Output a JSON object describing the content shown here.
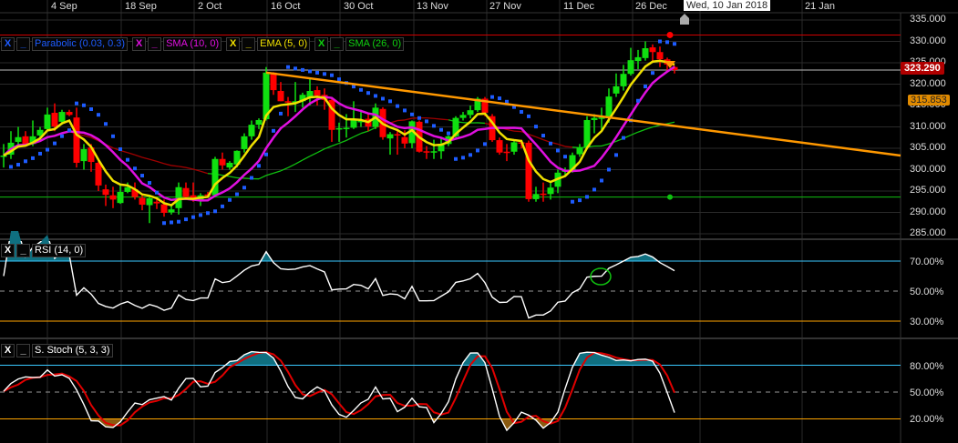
{
  "header": {
    "dates": [
      "4 Sep",
      "18 Sep",
      "2 Oct",
      "16 Oct",
      "30 Oct",
      "13 Nov",
      "27 Nov",
      "11 Dec",
      "26 Dec",
      "21 Jan"
    ],
    "crosshair_date": "Wed, 10 Jan 2018"
  },
  "legend": {
    "main": [
      {
        "label": "Parabolic (0.03, 0.3)",
        "color": "#1e5cff"
      },
      {
        "label": "SMA (10, 0)",
        "color": "#e010e0"
      },
      {
        "label": "EMA (5, 0)",
        "color": "#f0e000"
      },
      {
        "label": "SMA (26, 0)",
        "color": "#10d010"
      }
    ],
    "rsi": "RSI (14, 0)",
    "stoch": "S. Stoch (5, 3, 3)",
    "close_symbol": "X",
    "min_symbol": "_"
  },
  "axis": {
    "price_ticks": [
      "335.000",
      "330.000",
      "325.000",
      "320.000",
      "315.000",
      "310.000",
      "305.000",
      "300.000",
      "295.000",
      "290.000",
      "285.000"
    ],
    "rsi_ticks": [
      "70.00%",
      "50.00%",
      "30.00%"
    ],
    "stoch_ticks": [
      "80.00%",
      "50.00%",
      "20.00%"
    ]
  },
  "tags": {
    "last_price": "323.290",
    "orange_level": "315.853"
  },
  "chart_data": {
    "type": "candlestick",
    "ylim": [
      283,
      337
    ],
    "price_levels": {
      "last": 323.29,
      "resistance": 331.5,
      "support": 293.6,
      "trendline": [
        [
          36,
          322.7
        ],
        [
          123,
          303.3
        ]
      ]
    },
    "rsi_levels": [
      70,
      50,
      30
    ],
    "stoch_levels": [
      80,
      50,
      20
    ],
    "ohlc": [
      [
        303.0,
        306,
        300.5,
        303.3
      ],
      [
        303.5,
        309,
        302.5,
        306.3
      ],
      [
        306.5,
        310,
        305.5,
        307.6
      ],
      [
        307.8,
        309,
        306,
        306
      ],
      [
        306,
        311.5,
        305.5,
        307.8
      ],
      [
        308,
        310,
        306.5,
        309.3
      ],
      [
        309.5,
        314.5,
        309,
        312.9
      ],
      [
        313.3,
        315.5,
        309,
        310.1
      ],
      [
        311.2,
        314,
        310.5,
        313.5
      ],
      [
        313.5,
        314,
        312.5,
        312.8
      ],
      [
        312.2,
        314.5,
        300.5,
        301.6
      ],
      [
        302,
        306,
        300,
        304.8
      ],
      [
        305.2,
        306,
        299.5,
        301.8
      ],
      [
        301.6,
        302,
        295,
        296.3
      ],
      [
        295.4,
        296.5,
        291.5,
        294.1
      ],
      [
        294,
        296,
        291,
        293
      ],
      [
        292.2,
        296.5,
        292,
        294.8
      ],
      [
        294.8,
        297,
        294.5,
        295.9
      ],
      [
        295.4,
        297,
        293,
        293.6
      ],
      [
        293.4,
        294,
        290.5,
        291.8
      ],
      [
        291.7,
        294,
        287.5,
        293.3
      ],
      [
        292.5,
        293.5,
        290.8,
        292.1
      ],
      [
        291.9,
        293,
        289,
        289.9
      ],
      [
        290,
        292,
        289.5,
        290.7
      ],
      [
        291,
        297,
        289.5,
        295.9
      ],
      [
        295.7,
        297,
        293,
        293.6
      ],
      [
        294,
        297,
        292.5,
        293
      ],
      [
        292.9,
        294.5,
        291.5,
        294
      ],
      [
        294.2,
        294.8,
        293.6,
        294
      ],
      [
        294,
        303,
        293.8,
        302.5
      ],
      [
        302.5,
        304,
        300,
        301
      ],
      [
        300.5,
        302,
        300,
        301.6
      ],
      [
        301.2,
        304.5,
        300.5,
        304.4
      ],
      [
        304.8,
        308.5,
        304,
        307.8
      ],
      [
        307.8,
        311.5,
        307,
        310.5
      ],
      [
        310.5,
        312,
        309.5,
        311.6
      ],
      [
        311.8,
        324,
        311.5,
        322.7
      ],
      [
        322.7,
        322.8,
        317.5,
        318.6
      ],
      [
        318.4,
        320.5,
        316,
        316
      ],
      [
        316,
        317,
        312.5,
        315.7
      ],
      [
        315.8,
        320.5,
        313.5,
        316
      ],
      [
        316,
        318,
        314.5,
        317.5
      ],
      [
        316.9,
        321.5,
        315,
        318.4
      ],
      [
        318.6,
        319.5,
        315,
        317.3
      ],
      [
        317.5,
        319,
        314,
        316.3
      ],
      [
        316.3,
        317,
        306.5,
        309.3
      ],
      [
        309.5,
        311,
        306.5,
        309.7
      ],
      [
        309.6,
        313,
        307.5,
        309.8
      ],
      [
        309.8,
        316,
        309.5,
        311.7
      ],
      [
        311.4,
        314,
        310,
        311.4
      ],
      [
        311.9,
        313,
        309,
        310.1
      ],
      [
        310,
        315.5,
        309.5,
        314.5
      ],
      [
        314.2,
        314.6,
        307,
        307.6
      ],
      [
        307.3,
        308.8,
        303.5,
        308.3
      ],
      [
        308.3,
        309.5,
        303.5,
        308.0
      ],
      [
        307.6,
        309.2,
        305,
        306.1
      ],
      [
        306.2,
        311.5,
        305,
        311.3
      ],
      [
        311.2,
        311.5,
        304,
        304.2
      ],
      [
        304.3,
        305.5,
        302.5,
        304.2
      ],
      [
        304.2,
        307,
        302.5,
        304.3
      ],
      [
        304.3,
        307.5,
        302.5,
        306
      ],
      [
        306,
        308,
        305.5,
        307.8
      ],
      [
        307.8,
        312.5,
        307.5,
        312.1
      ],
      [
        312.1,
        313.5,
        311.5,
        312.8
      ],
      [
        312.8,
        315,
        312,
        313.9
      ],
      [
        313.9,
        317,
        313.5,
        316.6
      ],
      [
        316.6,
        317,
        312.5,
        313.3
      ],
      [
        312.5,
        313,
        306.5,
        306.9
      ],
      [
        306.9,
        307.5,
        303.5,
        304
      ],
      [
        304.2,
        306,
        302,
        304.1
      ],
      [
        304.2,
        307,
        303.5,
        306.4
      ],
      [
        306.4,
        307,
        305,
        306.3
      ],
      [
        306.3,
        306.8,
        292.5,
        293.1
      ],
      [
        293.1,
        296,
        292.5,
        294.3
      ],
      [
        294.4,
        297,
        292.5,
        294.3
      ],
      [
        294.3,
        297,
        293,
        295.8
      ],
      [
        296,
        300,
        294.5,
        299.3
      ],
      [
        299.6,
        300.5,
        298.5,
        299.8
      ],
      [
        299.9,
        304,
        299.3,
        303.4
      ],
      [
        303.6,
        306,
        303,
        305.2
      ],
      [
        305.2,
        312.5,
        305,
        311.6
      ],
      [
        311.6,
        313,
        308.5,
        312.1
      ],
      [
        312,
        314.5,
        309,
        312.2
      ],
      [
        312.2,
        319,
        311,
        317.1
      ],
      [
        317.8,
        322.5,
        317,
        319.5
      ],
      [
        319.5,
        324.5,
        318.5,
        322.4
      ],
      [
        322.4,
        328.5,
        322,
        325.6
      ],
      [
        325.4,
        328,
        323.5,
        326.3
      ],
      [
        326.1,
        330,
        325.5,
        328.4
      ],
      [
        328.6,
        329.3,
        325,
        327.5
      ],
      [
        327.5,
        328.8,
        324,
        325.8
      ],
      [
        325.8,
        326.2,
        323,
        324.6
      ],
      [
        324,
        324.3,
        322.5,
        323.3
      ]
    ],
    "colors": {
      "up": "#10e010",
      "down": "#ff0000",
      "psar": "#1e5cff",
      "sma10": "#e010e0",
      "ema5": "#f0e000",
      "sma26": "#10c010",
      "sma26_below": "#a00000",
      "trend": "#ff9800",
      "overbought": "#0f6f80",
      "oversold": "#8a5a10"
    }
  }
}
